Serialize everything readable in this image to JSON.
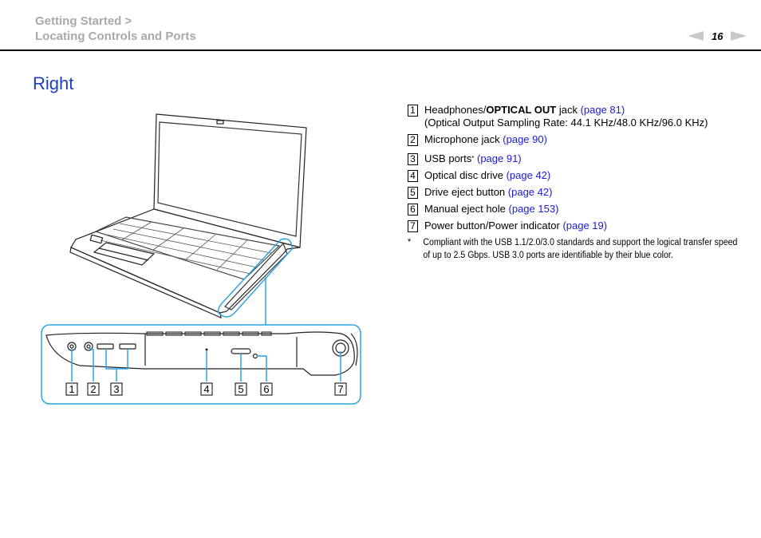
{
  "header": {
    "breadcrumb_line1": "Getting Started >",
    "breadcrumb_line2": "Locating Controls and Ports",
    "page_number": "16",
    "prev_icon": "arrow-left-icon",
    "next_icon": "arrow-right-icon"
  },
  "section": {
    "title": "Right"
  },
  "items": [
    {
      "num": "1",
      "pre": "Headphones/",
      "bold": "OPTICAL OUT",
      "post": " jack ",
      "link": "(page 81)",
      "sub": "(Optical Output Sampling Rate: 44.1 KHz/48.0 KHz/96.0 KHz)"
    },
    {
      "num": "2",
      "text": "Microphone jack ",
      "link": "(page 90)"
    },
    {
      "num": "3",
      "text": "USB ports",
      "sup": "*",
      "link": " (page 91)"
    },
    {
      "num": "4",
      "text": "Optical disc drive ",
      "link": "(page 42)"
    },
    {
      "num": "5",
      "text": "Drive eject button ",
      "link": "(page 42)"
    },
    {
      "num": "6",
      "text": "Manual eject hole ",
      "link": "(page 153)"
    },
    {
      "num": "7",
      "text": "Power button/Power indicator ",
      "link": "(page 19)"
    }
  ],
  "footnote": {
    "mark": "*",
    "text": "Compliant with the USB 1.1/2.0/3.0 standards and support the logical transfer speed of up to 2.5 Gbps. USB 3.0 ports are identifiable by their blue color."
  },
  "diagram": {
    "callouts": [
      "1",
      "2",
      "3",
      "4",
      "5",
      "6",
      "7"
    ],
    "accent_color": "#2aa6e0"
  }
}
